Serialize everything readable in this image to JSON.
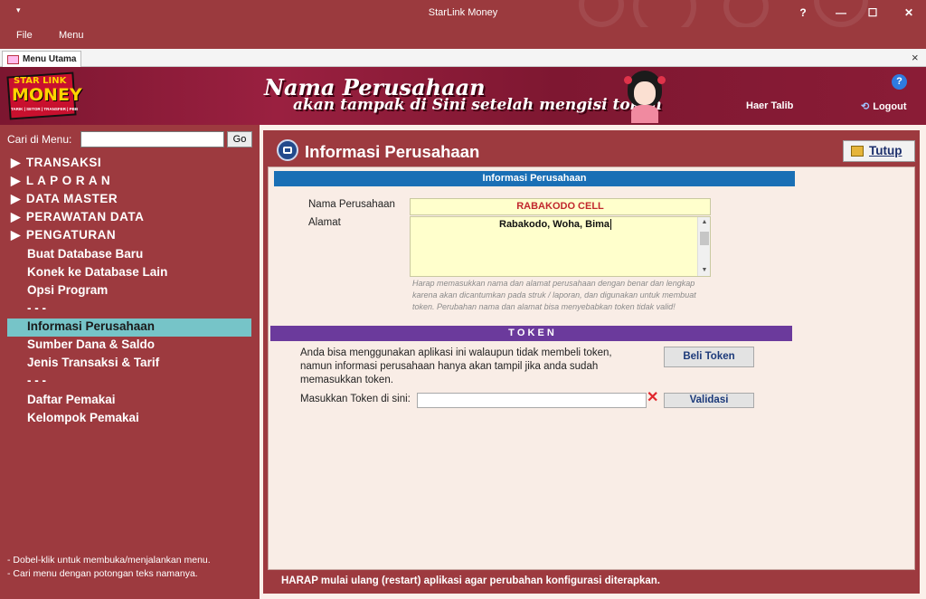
{
  "window": {
    "title": "StarLink Money",
    "controls": {
      "help": "?",
      "minimize": "—",
      "maximize": "☐",
      "close": "✕"
    }
  },
  "menubar": {
    "items": [
      "File",
      "Menu"
    ]
  },
  "tabstrip": {
    "tab_label": "Menu Utama",
    "close": "×"
  },
  "banner": {
    "logo": {
      "line1": "STAR LINK",
      "line2": "MONEY",
      "line3": "TARIK | SETOR | TRANSFER | PBB"
    },
    "line1": "Nama Perusahaan",
    "line2": "akan tampak di Sini setelah mengisi token",
    "user": "Haer Talib",
    "logout": "Logout",
    "help": "?"
  },
  "sidebar": {
    "search_label": "Cari di Menu:",
    "search_value": "",
    "go_label": "Go",
    "items": [
      {
        "label": "TRANSAKSI",
        "expandable": true
      },
      {
        "label": "L A P O R A N",
        "expandable": true
      },
      {
        "label": "DATA MASTER",
        "expandable": true
      },
      {
        "label": "PERAWATAN DATA",
        "expandable": true
      },
      {
        "label": "PENGATURAN",
        "expandable": true
      },
      {
        "label": "Buat Database Baru"
      },
      {
        "label": "Konek ke Database Lain"
      },
      {
        "label": "Opsi Program"
      },
      {
        "label": "- - -"
      },
      {
        "label": "Informasi Perusahaan",
        "selected": true
      },
      {
        "label": "Sumber Dana & Saldo"
      },
      {
        "label": "Jenis Transaksi & Tarif"
      },
      {
        "label": "- - -"
      },
      {
        "label": "Daftar Pemakai"
      },
      {
        "label": "Kelompok Pemakai"
      }
    ],
    "hints": [
      "- Dobel-klik untuk membuka/menjalankan menu.",
      "- Cari menu dengan potongan teks namanya."
    ]
  },
  "main": {
    "title": "Informasi Perusahaan",
    "close_button": "Tutup",
    "info_section": "Informasi Perusahaan",
    "nama_label": "Nama Perusahaan",
    "nama_value": "RABAKODO CELL",
    "alamat_label": "Alamat",
    "alamat_value": "Rabakodo, Woha, Bima",
    "note": "Harap memasukkan nama dan alamat perusahaan dengan benar dan lengkap karena akan dicantumkan pada struk / laporan, dan digunakan untuk membuat token. Perubahan nama dan alamat bisa menyebabkan token tidak valid!",
    "token_section": "T O K E N",
    "token_text": "Anda bisa menggunakan aplikasi ini walaupun tidak membeli token, namun informasi perusahaan hanya akan tampil jika anda sudah memasukkan token.",
    "beli_token": "Beli Token",
    "token_label": "Masukkan Token di sini:",
    "token_value": "",
    "validasi": "Validasi",
    "footer": "HARAP mulai ulang (restart) aplikasi agar perubahan konfigurasi diterapkan."
  },
  "colors": {
    "titlebar": "#9b3a3e",
    "sidebar": "#9d3a3f",
    "selected": "#76c4c8",
    "info_bar": "#1a6fb5",
    "token_bar": "#6b3a9c",
    "field": "#ffffcc"
  }
}
